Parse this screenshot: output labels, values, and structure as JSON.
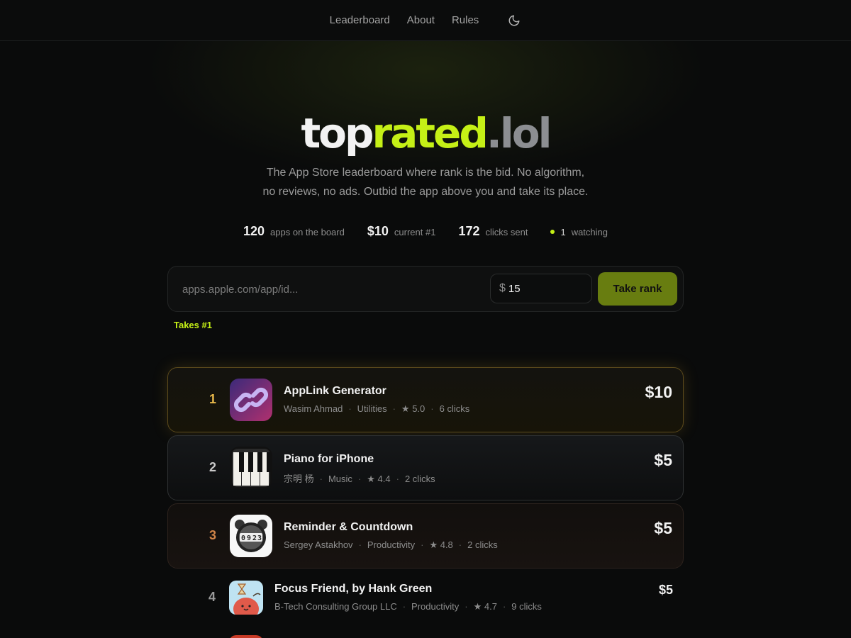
{
  "nav": {
    "items": [
      "Leaderboard",
      "About",
      "Rules"
    ],
    "theme_icon": "moon-icon"
  },
  "hero": {
    "logo_part1": "top",
    "logo_part2": "rated",
    "logo_part3": ".lol",
    "tagline_line1": "The App Store leaderboard where rank is the bid. No algorithm,",
    "tagline_line2": "no reviews, no ads. Outbid the app above you and take its place."
  },
  "stats": {
    "apps_count": "120",
    "apps_label": "apps on the board",
    "current_price": "$10",
    "current_label": "current #1",
    "clicks_count": "172",
    "clicks_label": "clicks sent",
    "watching_count": "1",
    "watching_label": "watching"
  },
  "form": {
    "url_placeholder": "apps.apple.com/app/id...",
    "currency": "$",
    "bid_value": "15",
    "submit_label": "Take rank",
    "hint": "Takes #1"
  },
  "apps": [
    {
      "rank": "1",
      "name": "AppLink Generator",
      "developer": "Wasim Ahmad",
      "category": "Utilities",
      "rating": "★ 5.0",
      "clicks": "6 clicks",
      "price": "$10",
      "icon": "link-icon"
    },
    {
      "rank": "2",
      "name": "Piano for iPhone",
      "developer": "宗明 杨",
      "category": "Music",
      "rating": "★ 4.4",
      "clicks": "2 clicks",
      "price": "$5",
      "icon": "piano-keys-icon"
    },
    {
      "rank": "3",
      "name": "Reminder & Countdown",
      "developer": "Sergey Astakhov",
      "category": "Productivity",
      "rating": "★ 4.8",
      "clicks": "2 clicks",
      "price": "$5",
      "icon": "alarm-clock-icon"
    },
    {
      "rank": "4",
      "name": "Focus Friend, by Hank Green",
      "developer": "B-Tech Consulting Group LLC",
      "category": "Productivity",
      "rating": "★ 4.7",
      "clicks": "9 clicks",
      "price": "$5",
      "icon": "focus-bean-icon"
    }
  ],
  "colors": {
    "accent": "#c5f016",
    "background": "#0a0b0b",
    "gold": "#e8b84a",
    "bronze": "#d08448"
  }
}
